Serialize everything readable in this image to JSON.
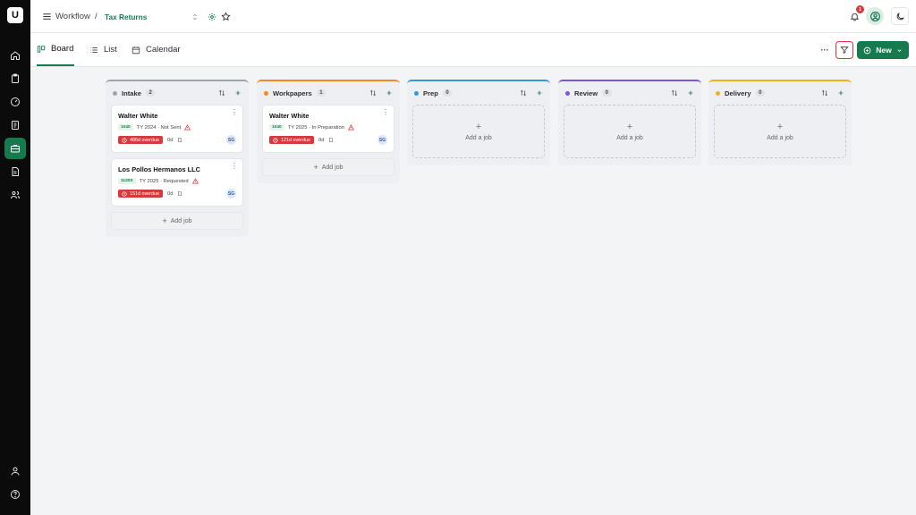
{
  "app": {
    "logo": "U"
  },
  "sidebar": {
    "items": [
      {
        "name": "home-icon"
      },
      {
        "name": "clipboard-icon"
      },
      {
        "name": "gauge-icon"
      },
      {
        "name": "checklist-icon"
      },
      {
        "name": "briefcase-icon",
        "active": true
      },
      {
        "name": "document-icon"
      },
      {
        "name": "people-icon"
      }
    ],
    "bottom": [
      {
        "name": "user-icon"
      },
      {
        "name": "help-icon"
      }
    ]
  },
  "header": {
    "menu_icon": "menu-icon",
    "breadcrumb_root": "Workflow",
    "separator": "/",
    "current": "Tax Returns",
    "notification_count": "1",
    "accent": "#167a4f"
  },
  "tabs": [
    {
      "label": "Board",
      "active": true
    },
    {
      "label": "List"
    },
    {
      "label": "Calendar"
    }
  ],
  "toolbar": {
    "more": "···",
    "new_label": "New"
  },
  "columns": [
    {
      "name": "Intake",
      "count": "2",
      "color": "#9ca3af",
      "cards": [
        {
          "title": "Walter White",
          "form": "1040",
          "meta": "TY 2024 · Not Sent",
          "overdue": "486d overdue",
          "days": "0d",
          "assignee": "SG"
        },
        {
          "title": "Los Pollos Hermanos LLC",
          "form": "1120S",
          "meta": "TY 2025 · Requested",
          "overdue": "151d overdue",
          "days": "0d",
          "assignee": "SG"
        }
      ],
      "add_label": "Add job"
    },
    {
      "name": "Workpapers",
      "count": "1",
      "color": "#f08a24",
      "cards": [
        {
          "title": "Walter White",
          "form": "1040",
          "meta": "TY 2025 · In Preparation",
          "overdue": "121d overdue",
          "days": "0d",
          "assignee": "SG"
        }
      ],
      "add_label": "Add job"
    },
    {
      "name": "Prep",
      "count": "0",
      "color": "#2e9bd6",
      "empty_label": "Add a job"
    },
    {
      "name": "Review",
      "count": "0",
      "color": "#7b55d9",
      "empty_label": "Add a job"
    },
    {
      "name": "Delivery",
      "count": "0",
      "color": "#f2b01e",
      "empty_label": "Add a job"
    }
  ]
}
